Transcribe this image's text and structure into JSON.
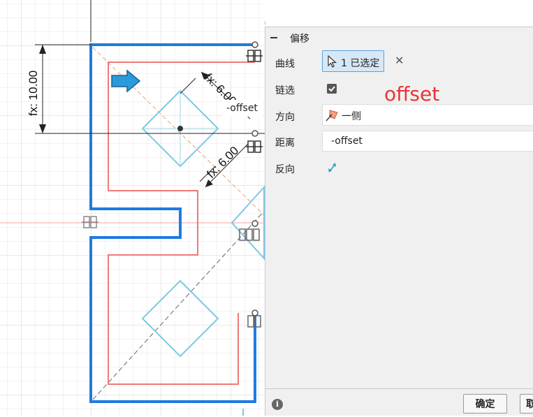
{
  "canvas": {
    "dimension_vertical": "fx: 10.00",
    "dimension_diag_top": "fx: 6.00",
    "dimension_diag_bottom": "fx: 6.00",
    "floating_value": "-offset"
  },
  "panel": {
    "title": "偏移",
    "rows": {
      "curve_label": "曲线",
      "curve_selection": "1 已选定",
      "chain_label": "链选",
      "chain_checked": true,
      "direction_label": "方向",
      "direction_value": "一侧",
      "distance_label": "距离",
      "distance_value": "-offset",
      "flip_label": "反向"
    },
    "annotation": "offset",
    "buttons": {
      "ok": "确定",
      "cancel": "取消"
    }
  },
  "colors": {
    "path_blue": "#1e7be0",
    "offset_red": "#f07878",
    "diamond": "#7ec8e3",
    "annotation_red": "#e8353a",
    "selection_bg": "#d6e8f7"
  }
}
